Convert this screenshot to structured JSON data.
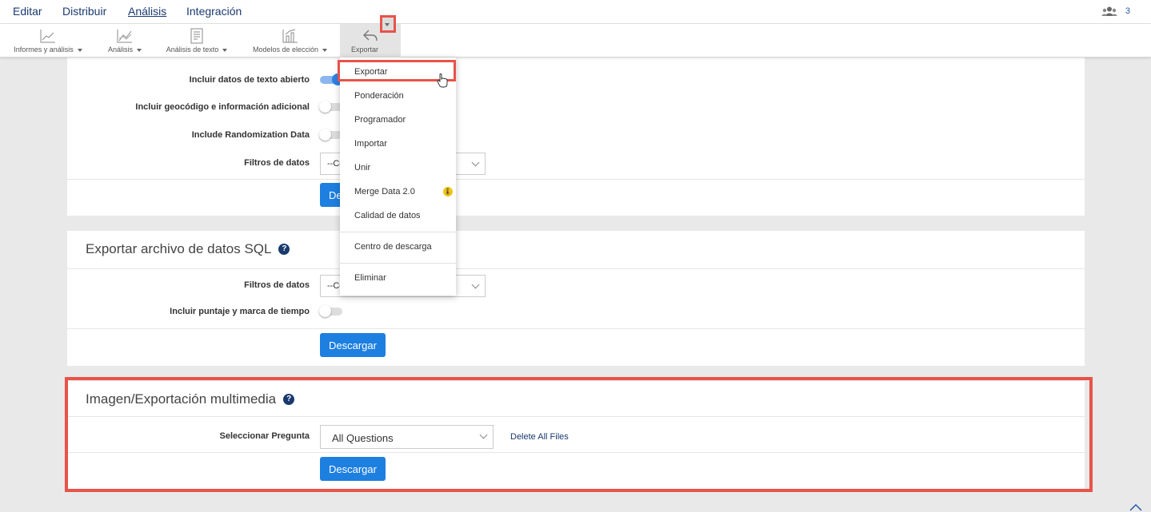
{
  "nav": {
    "tabs": [
      "Editar",
      "Distribuir",
      "Análisis",
      "Integración"
    ],
    "active_tab": "Análisis",
    "collaborators_count": "3"
  },
  "toolbar": {
    "items": [
      {
        "label": "Informes y análisis",
        "icon": "line-chart-icon"
      },
      {
        "label": "Análisis",
        "icon": "trend-chart-icon"
      },
      {
        "label": "Análisis de texto",
        "icon": "text-analysis-icon"
      },
      {
        "label": "Modelos de elección",
        "icon": "choice-model-icon"
      },
      {
        "label": "Exportar",
        "icon": "export-icon"
      }
    ]
  },
  "dropdown": {
    "items": [
      "Exportar",
      "Ponderación",
      "Programador",
      "Importar",
      "Unir",
      "Merge Data 2.0",
      "Calidad de datos",
      "Centro de descarga",
      "Eliminar"
    ],
    "beta_badge": "🌡"
  },
  "panel1": {
    "rows": [
      {
        "label": "Incluir datos de texto abierto",
        "toggle": "on"
      },
      {
        "label": "Incluir geocódigo e información adicional",
        "toggle": "off"
      },
      {
        "label": "Include Randomization Data",
        "toggle": "off"
      }
    ],
    "filter_label": "Filtros de datos",
    "filter_value": "--Co",
    "button": "De"
  },
  "panel2": {
    "title": "Exportar archivo de datos SQL",
    "filter_label": "Filtros de datos",
    "filter_value": "--Co",
    "timestamp_label": "Incluir puntaje y marca de tiempo",
    "button": "Descargar"
  },
  "panel3": {
    "title": "Imagen/Exportación multimedia",
    "question_label": "Seleccionar Pregunta",
    "question_value": "All Questions",
    "delete_link": "Delete All Files",
    "button": "Descargar"
  },
  "help_glyph": "?"
}
